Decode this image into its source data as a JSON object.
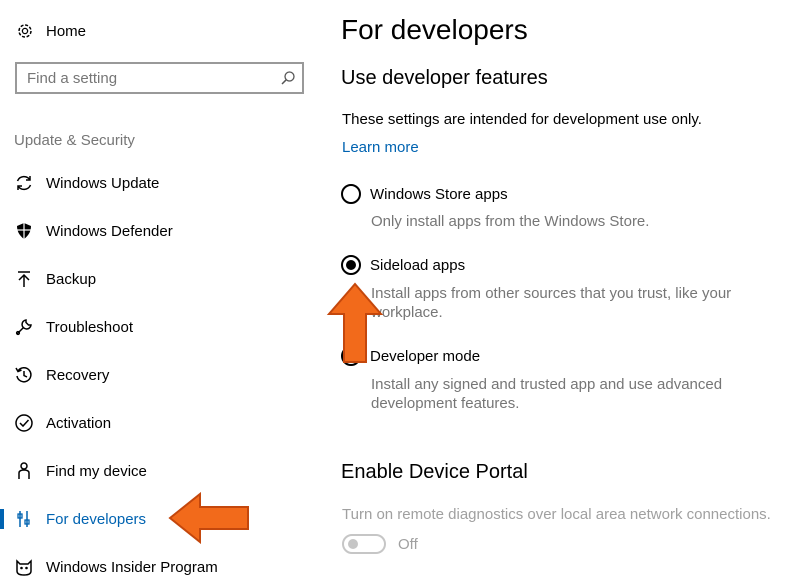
{
  "sidebar": {
    "home": {
      "label": "Home",
      "icon": "gear-icon"
    },
    "search": {
      "placeholder": "Find a setting",
      "value": "",
      "icon": "search-icon"
    },
    "section_title": "Update & Security",
    "items": [
      {
        "label": "Windows Update",
        "icon": "refresh-icon",
        "active": false
      },
      {
        "label": "Windows Defender",
        "icon": "shield-icon",
        "active": false
      },
      {
        "label": "Backup",
        "icon": "upload-arrow-icon",
        "active": false
      },
      {
        "label": "Troubleshoot",
        "icon": "wrench-icon",
        "active": false
      },
      {
        "label": "Recovery",
        "icon": "history-icon",
        "active": false
      },
      {
        "label": "Activation",
        "icon": "check-circle-icon",
        "active": false
      },
      {
        "label": "Find my device",
        "icon": "person-icon",
        "active": false
      },
      {
        "label": "For developers",
        "icon": "developer-tools-icon",
        "active": true
      },
      {
        "label": "Windows Insider Program",
        "icon": "insider-cat-icon",
        "active": false
      }
    ]
  },
  "main": {
    "title": "For developers",
    "developer_features": {
      "heading": "Use developer features",
      "description": "These settings are intended for development use only.",
      "learn_more": "Learn more",
      "options": [
        {
          "label": "Windows Store apps",
          "description": "Only install apps from the Windows Store.",
          "checked": false
        },
        {
          "label": "Sideload apps",
          "description": "Install apps from other sources that you trust, like your workplace.",
          "checked": true
        },
        {
          "label": "Developer mode",
          "description": "Install any signed and trusted app and use advanced development features.",
          "checked": false
        }
      ]
    },
    "device_portal": {
      "heading": "Enable Device Portal",
      "description": "Turn on remote diagnostics over local area network connections.",
      "toggle_state": "Off",
      "enabled": false
    }
  },
  "colors": {
    "accent": "#0063b1",
    "secondary_text": "#767676",
    "disabled_text": "#a0a0a0",
    "annotation_arrow": "#f26a1b"
  }
}
